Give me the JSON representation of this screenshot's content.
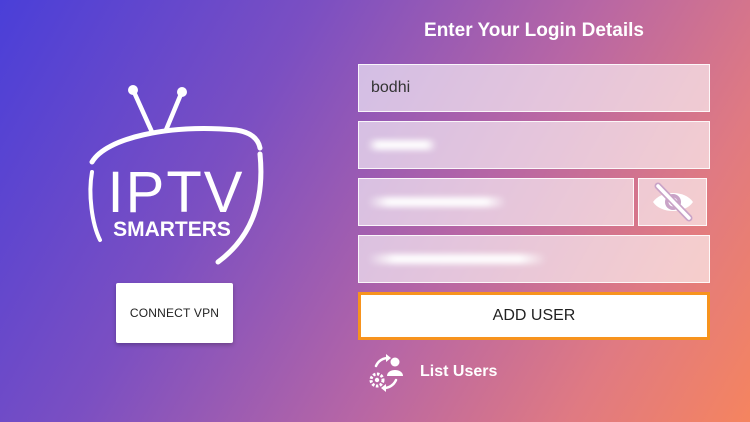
{
  "brand": {
    "name_top": "IPTV",
    "name_bottom": "SMARTERS"
  },
  "left_panel": {
    "connect_vpn_label": "CONNECT VPN"
  },
  "form": {
    "title": "Enter Your Login Details",
    "username_value": "bodhi",
    "add_user_label": "ADD USER"
  },
  "list_users": {
    "label": "List Users",
    "icon": "users-sync-icon"
  },
  "icons": {
    "password_toggle": "eye-slash-icon",
    "logo": "tv-antenna-logo"
  },
  "colors": {
    "accent_border": "#f7931e",
    "gradient_start": "#4a3fd8",
    "gradient_end": "#f5845f"
  }
}
